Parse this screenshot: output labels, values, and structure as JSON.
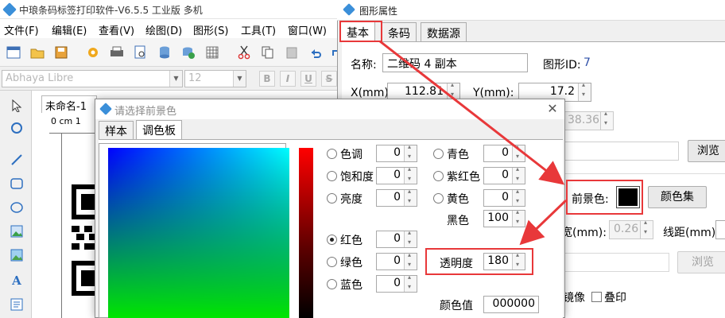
{
  "app": {
    "title": "中琅条码标签打印软件-V6.5.5 工业版 多机",
    "menu": [
      "文件(F)",
      "编辑(E)",
      "查看(V)",
      "绘图(D)",
      "图形(S)",
      "工具(T)",
      "窗口(W)"
    ],
    "font_name": "Abhaya Libre",
    "font_size": "12",
    "format_buttons": [
      "B",
      "I",
      "U",
      "S"
    ],
    "doc_tab": "未命名-1",
    "ruler_label": "0 cm 1"
  },
  "props": {
    "title": "图形属性",
    "tabs": [
      "基本",
      "条码",
      "数据源"
    ],
    "name_label": "名称:",
    "name_value": "二维码 4 副本",
    "id_label": "图形ID:",
    "id_value": "7",
    "x_label": "X(mm):",
    "x_value": "112.81",
    "y_label": "Y(mm):",
    "y_value": "17.2",
    "h_value": "38.36",
    "browse_label": "浏览",
    "fg_label": "前景色:",
    "fg_color": "#000000",
    "colorset_label": "颜色集",
    "width_label": "宽(mm):",
    "width_value": "0.26",
    "spacing_label": "线距(mm):",
    "browse2_label": "浏览",
    "mirror_label": "镜像",
    "overprint_label": "叠印"
  },
  "color_dialog": {
    "title": "请选择前景色",
    "close_glyph": "✕",
    "tabs": [
      "样本",
      "调色板"
    ],
    "hue_label": "色调",
    "hue_value": "0",
    "saturation_label": "饱和度",
    "saturation_value": "0",
    "brightness_label": "亮度",
    "brightness_value": "0",
    "cyan_label": "青色",
    "cyan_value": "0",
    "magenta_label": "紫红色",
    "magenta_value": "0",
    "yellow_label": "黄色",
    "yellow_value": "0",
    "black_label": "黑色",
    "black_value": "100",
    "red_label": "红色",
    "red_value": "0",
    "green_label": "绿色",
    "green_value": "0",
    "blue_label": "蓝色",
    "blue_value": "0",
    "opacity_label": "透明度",
    "opacity_value": "180",
    "color_value_label": "颜色值",
    "color_value": "000000"
  },
  "annotation_color": "#e8383a"
}
